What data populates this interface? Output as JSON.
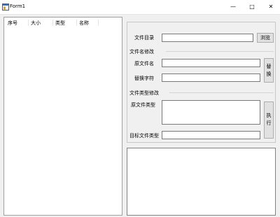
{
  "window": {
    "title": "Form1",
    "minimize_glyph": "—",
    "maximize_glyph": "□",
    "close_glyph": "✕",
    "icon": "app-form-icon"
  },
  "file_list": {
    "columns": [
      "序号",
      "大小",
      "类型",
      "名称"
    ]
  },
  "directory": {
    "label": "文件目录",
    "value": "",
    "browse_label": "浏览"
  },
  "rename_group": {
    "title": "文件名修改",
    "source_label": "原文件名",
    "source_value": "",
    "replace_label": "替换字符",
    "replace_value": "",
    "replace_button_chars": [
      "替",
      "换"
    ]
  },
  "type_group": {
    "title": "文件类型修改",
    "source_types_label": "原文件类型",
    "source_types_value": "",
    "target_type_label": "目标文件类型",
    "target_type_value": "",
    "execute_button_chars": [
      "执",
      "行"
    ]
  },
  "log": {
    "content": ""
  }
}
